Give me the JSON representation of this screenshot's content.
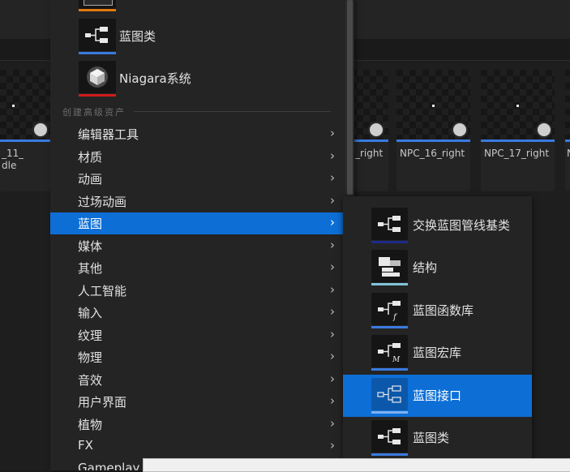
{
  "background": {
    "cards": [
      {
        "label": "_11_",
        "label2": "dle"
      },
      {
        "label": "_right"
      },
      {
        "label": "NPC_16_right"
      },
      {
        "label": "NPC_17_right"
      },
      {
        "label": "N"
      }
    ]
  },
  "menu": {
    "top_assets": [
      {
        "label": "蓝图类",
        "icon": "blueprint-class-icon",
        "bar_color": "#3a7ae0"
      },
      {
        "label": "Niagara系统",
        "icon": "niagara-system-icon",
        "bar_color": "#d11a1a"
      }
    ],
    "top_cut_bar_color": "#e07a10",
    "section_title": "创建高级资产",
    "items": [
      {
        "label": "编辑器工具",
        "selected": false
      },
      {
        "label": "材质",
        "selected": false
      },
      {
        "label": "动画",
        "selected": false
      },
      {
        "label": "过场动画",
        "selected": false
      },
      {
        "label": "蓝图",
        "selected": true
      },
      {
        "label": "媒体",
        "selected": false
      },
      {
        "label": "其他",
        "selected": false
      },
      {
        "label": "人工智能",
        "selected": false
      },
      {
        "label": "输入",
        "selected": false
      },
      {
        "label": "纹理",
        "selected": false
      },
      {
        "label": "物理",
        "selected": false
      },
      {
        "label": "音效",
        "selected": false
      },
      {
        "label": "用户界面",
        "selected": false
      },
      {
        "label": "植物",
        "selected": false
      },
      {
        "label": "FX",
        "selected": false
      },
      {
        "label": "Gameplay",
        "selected": false
      }
    ],
    "chevron": "›"
  },
  "submenu": {
    "items": [
      {
        "label": "交换蓝图管线基类",
        "icon": "blueprint-pipeline-icon",
        "bar_color": "#1d2a8a",
        "selected": false
      },
      {
        "label": "结构",
        "icon": "struct-icon",
        "bar_color": "#7fc4d8",
        "selected": false
      },
      {
        "label": "蓝图函数库",
        "icon": "function-library-icon",
        "bar_color": "#3a7ae0",
        "selected": false
      },
      {
        "label": "蓝图宏库",
        "icon": "macro-library-icon",
        "bar_color": "#3a7ae0",
        "selected": false
      },
      {
        "label": "蓝图接口",
        "icon": "blueprint-interface-icon",
        "bar_color": "#7fb0f0",
        "selected": true
      },
      {
        "label": "蓝图类",
        "icon": "blueprint-class-icon",
        "bar_color": "#3a7ae0",
        "selected": false
      }
    ]
  },
  "colors": {
    "selection": "#0d6fd6",
    "menu_bg": "#242424"
  }
}
